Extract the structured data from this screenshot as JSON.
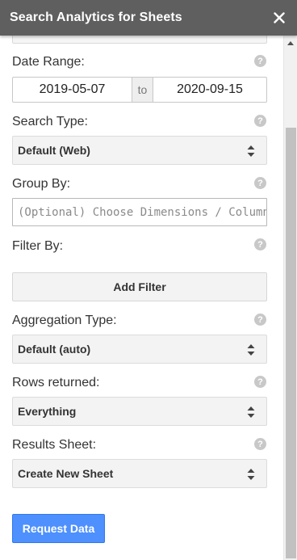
{
  "header": {
    "title": "Search Analytics for Sheets",
    "close_icon": "close-icon"
  },
  "form": {
    "date_range": {
      "label": "Date Range:",
      "start": "2019-05-07",
      "separator": "to",
      "end": "2020-09-15"
    },
    "search_type": {
      "label": "Search Type:",
      "value": "Default (Web)"
    },
    "group_by": {
      "label": "Group By:",
      "placeholder": "(Optional) Choose Dimensions / Columns"
    },
    "filter_by": {
      "label": "Filter By:",
      "button": "Add Filter"
    },
    "aggregation_type": {
      "label": "Aggregation Type:",
      "value": "Default (auto)"
    },
    "rows_returned": {
      "label": "Rows returned:",
      "value": "Everything"
    },
    "results_sheet": {
      "label": "Results Sheet:",
      "value": "Create New Sheet"
    },
    "submit": "Request Data",
    "help_glyph": "?"
  },
  "colors": {
    "header_bg": "#5f5f5f",
    "primary_button": "#4d90fe",
    "select_bg": "#f3f3f3",
    "help_icon": "#c8c8c8",
    "scrollbar_thumb": "#c1c1c1"
  }
}
